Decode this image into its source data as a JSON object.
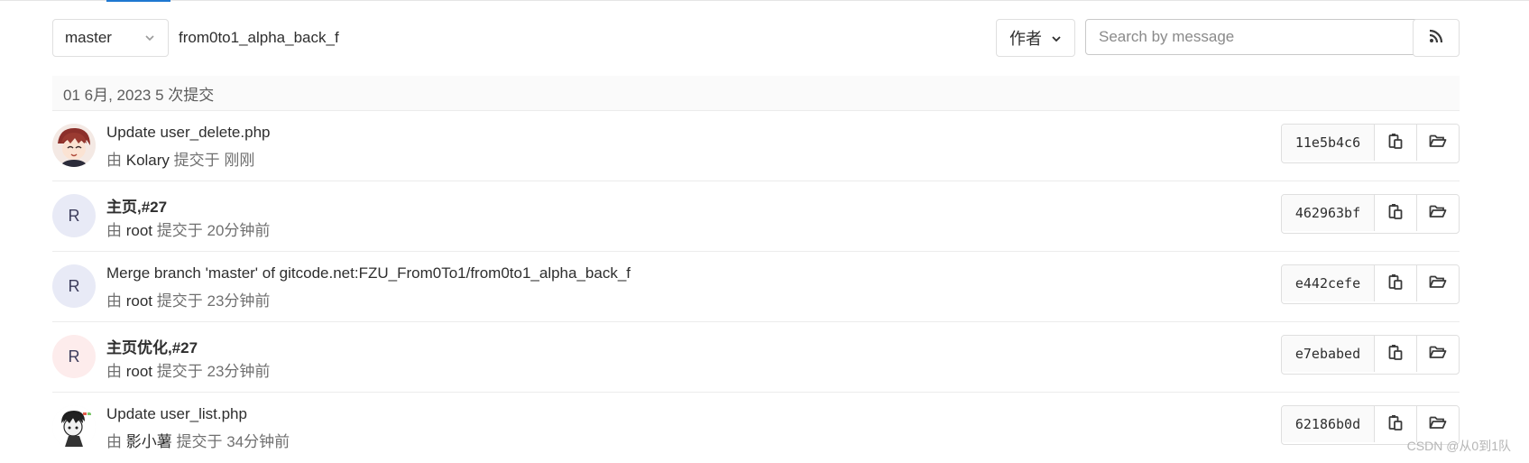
{
  "toolbar": {
    "branch": "master",
    "path": "from0to1_alpha_back_f",
    "author_label": "作者",
    "search_placeholder": "Search by message",
    "rss_icon": "rss-icon"
  },
  "day_header": "01 6月, 2023 5 次提交",
  "commits": [
    {
      "title": "Update user_delete.php",
      "by": "由",
      "author": "Kolary",
      "submitted": "提交于",
      "time": "刚刚",
      "sha": "11e5b4c6",
      "avatar_letter": "",
      "avatar_type": "image",
      "bold": false
    },
    {
      "title": "主页,#27",
      "by": "由",
      "author": "root",
      "submitted": "提交于",
      "time": "20分钟前",
      "sha": "462963bf",
      "avatar_letter": "R",
      "avatar_type": "letter-blue",
      "bold": true
    },
    {
      "title": "Merge branch 'master' of gitcode.net:FZU_From0To1/from0to1_alpha_back_f",
      "by": "由",
      "author": "root",
      "submitted": "提交于",
      "time": "23分钟前",
      "sha": "e442cefe",
      "avatar_letter": "R",
      "avatar_type": "letter-blue",
      "bold": false
    },
    {
      "title": "主页优化,#27",
      "by": "由",
      "author": "root",
      "submitted": "提交于",
      "time": "23分钟前",
      "sha": "e7ebabed",
      "avatar_letter": "R",
      "avatar_type": "letter-pink",
      "bold": true
    },
    {
      "title": "Update user_list.php",
      "by": "由",
      "author": "影小薯",
      "submitted": "提交于",
      "time": "34分钟前",
      "sha": "62186b0d",
      "avatar_letter": "",
      "avatar_type": "image",
      "bold": false
    }
  ],
  "row_actions": {
    "copy_icon": "copy-icon",
    "browse_icon": "folder-open-icon"
  },
  "watermark": "CSDN @从0到1队",
  "colors": {
    "accent": "#1f78d1",
    "border": "#dfdfdf",
    "muted": "#707070"
  }
}
